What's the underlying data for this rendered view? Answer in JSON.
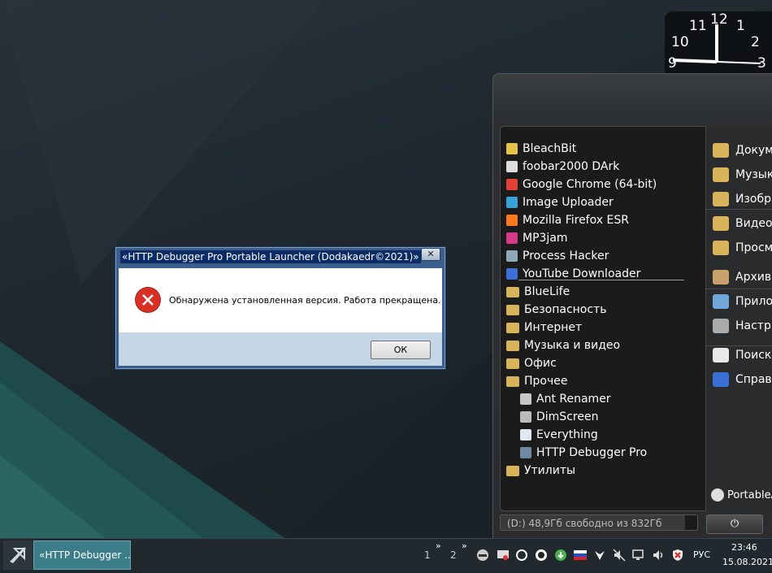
{
  "clock": {
    "numbers": [
      "10",
      "11",
      "12",
      "1",
      "2",
      "9",
      "3"
    ]
  },
  "launcher": {
    "apps": [
      {
        "label": "BleachBit",
        "icon": "bleachbit-icon",
        "color": "#e6c24a"
      },
      {
        "label": "foobar2000 DArk",
        "icon": "foobar-icon",
        "color": "#dddddd"
      },
      {
        "label": "Google Chrome (64-bit)",
        "icon": "chrome-icon",
        "color": "#e34133"
      },
      {
        "label": "Image Uploader",
        "icon": "image-uploader-icon",
        "color": "#3aa0d8"
      },
      {
        "label": "Mozilla Firefox ESR",
        "icon": "firefox-icon",
        "color": "#ff7a1a"
      },
      {
        "label": "MP3jam",
        "icon": "mp3jam-icon",
        "color": "#d83a8a"
      },
      {
        "label": "Process Hacker",
        "icon": "process-hacker-icon",
        "color": "#8fa8b8"
      },
      {
        "label": "YouTube Downloader",
        "icon": "youtube-downloader-icon",
        "color": "#3a6fd8"
      },
      {
        "label": "BlueLife",
        "icon": "folder-icon",
        "color": "#d9b35a"
      },
      {
        "label": "Безопасность",
        "icon": "folder-icon",
        "color": "#d9b35a"
      },
      {
        "label": "Интернет",
        "icon": "folder-icon",
        "color": "#d9b35a"
      },
      {
        "label": "Музыка и видео",
        "icon": "folder-icon",
        "color": "#d9b35a"
      },
      {
        "label": "Офис",
        "icon": "folder-icon",
        "color": "#d9b35a"
      },
      {
        "label": "Прочее",
        "icon": "folder-open-icon",
        "color": "#d9b35a"
      },
      {
        "label": "Ant Renamer",
        "icon": "ant-renamer-icon",
        "color": "#c8c8c8",
        "sub": true
      },
      {
        "label": "DimScreen",
        "icon": "dimscreen-icon",
        "color": "#bbbbbb",
        "sub": true
      },
      {
        "label": "Everything",
        "icon": "everything-icon",
        "color": "#dfe8f0",
        "sub": true
      },
      {
        "label": "HTTP Debugger Pro",
        "icon": "http-debugger-icon",
        "color": "#6f8aa0",
        "sub": true
      },
      {
        "label": "Утилиты",
        "icon": "folder-icon",
        "color": "#d9b35a"
      }
    ],
    "right_items": [
      {
        "label": "Докум",
        "icon": "documents-icon"
      },
      {
        "label": "Музык",
        "icon": "music-icon"
      },
      {
        "label": "Изобр",
        "icon": "pictures-icon"
      },
      {
        "label": "Видео",
        "icon": "videos-icon"
      },
      {
        "label": "Просм",
        "icon": "explore-icon"
      },
      {
        "label": "Архив",
        "icon": "archive-icon"
      },
      {
        "label": "Прило",
        "icon": "apps-icon"
      },
      {
        "label": "Настр",
        "icon": "settings-icon"
      },
      {
        "label": "Поиск",
        "icon": "search-icon"
      },
      {
        "label": "Справ",
        "icon": "help-icon"
      }
    ],
    "logo_text": "PortableA",
    "status": "(D:) 48,9Гб свободно из 832Гб",
    "power_symbol": "⏻"
  },
  "dialog": {
    "title": "«HTTP Debugger Pro Portable Launcher (Dodakaedr©2021)»",
    "close_symbol": "✕",
    "message": "Обнаружена установленная версия. Работа прекращена.",
    "ok_label": "ОК"
  },
  "taskbar": {
    "task_label": "«HTTP Debugger ...",
    "desktop_nums": [
      "1",
      "2"
    ],
    "chevrons": [
      "»",
      "»"
    ],
    "lang": "РУС",
    "time": "23:46",
    "date": "15.08.2021"
  },
  "colors": {
    "accent_teal": "#3c7d8a",
    "dialog_frame": "#3b5f8a",
    "error_red": "#d93025"
  }
}
